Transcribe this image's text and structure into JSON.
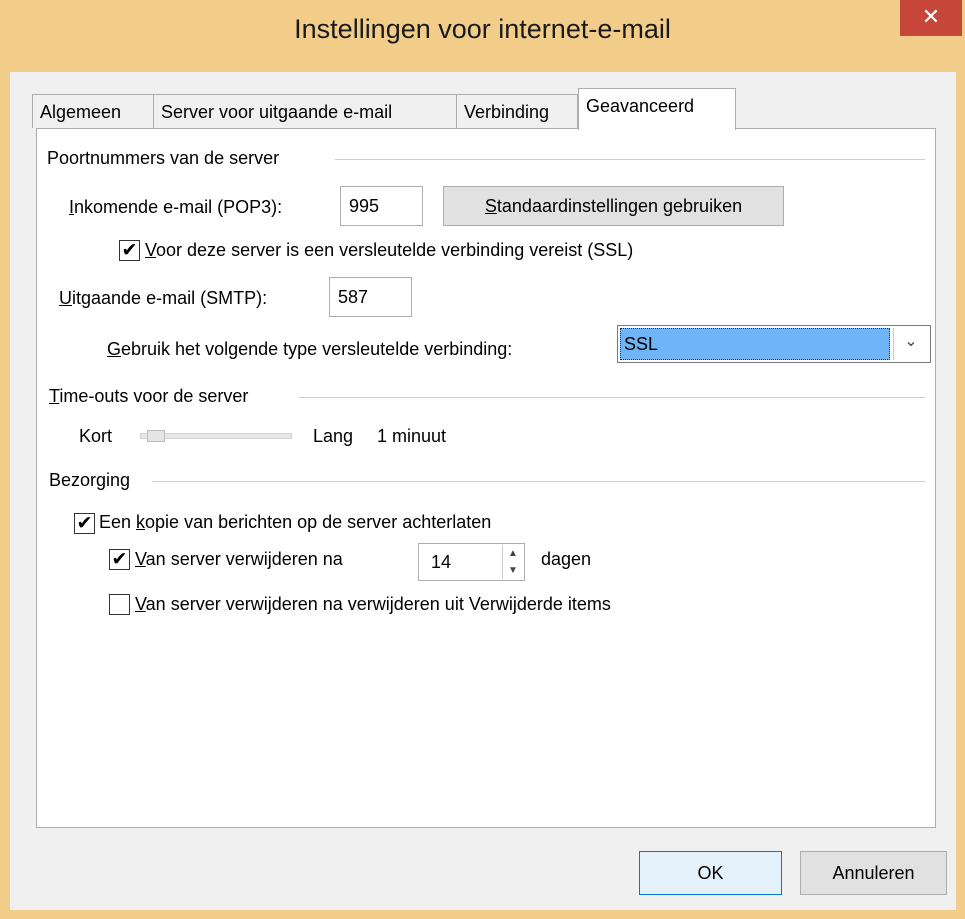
{
  "window": {
    "title": "Instellingen voor internet-e-mail",
    "close_glyph": "✕"
  },
  "tabs": [
    {
      "label": "Algemeen",
      "active": false
    },
    {
      "label": "Server voor uitgaande e-mail",
      "active": false
    },
    {
      "label": "Verbinding",
      "active": false
    },
    {
      "label": "Geavanceerd",
      "active": true
    }
  ],
  "ports": {
    "group_label": "Poortnummers van de server",
    "incoming_label_pre": "I",
    "incoming_label_rest": "nkomende e-mail (POP3):",
    "incoming_value": "995",
    "defaults_button_pre": "S",
    "defaults_button_rest": "tandaardinstellingen gebruiken",
    "ssl_required_pre": "V",
    "ssl_required_rest": "oor deze server is een versleutelde verbinding vereist (SSL)",
    "ssl_required_checked": true,
    "outgoing_label_pre": "U",
    "outgoing_label_rest": "itgaande e-mail (SMTP):",
    "outgoing_value": "587",
    "encryption_label_pre": "G",
    "encryption_label_rest": "ebruik het volgende type versleutelde verbinding:",
    "encryption_value": "SSL",
    "dropdown_icon": "chevron-down-icon",
    "dropdown_glyph": "⌄"
  },
  "timeouts": {
    "group_label_pre": "T",
    "group_label_rest": "ime-outs voor de server",
    "short_label": "Kort",
    "long_label": "Lang",
    "value_label": "1 minuut",
    "slider_level": 0.1
  },
  "delivery": {
    "group_label": "Bezorging",
    "leave_copy_pre": "Een ",
    "leave_copy_key": "k",
    "leave_copy_rest": "opie van berichten op de server achterlaten",
    "leave_copy_checked": true,
    "remove_after_pre": "V",
    "remove_after_rest": "an server verwijderen na",
    "remove_after_checked": true,
    "remove_after_days": "14",
    "days_label": "dagen",
    "remove_when_deleted_pre": "V",
    "remove_when_deleted_rest": "an server verwijderen na verwijderen uit Verwijderde items",
    "remove_when_deleted_checked": false
  },
  "footer": {
    "ok_label": "OK",
    "cancel_label": "Annuleren"
  },
  "check_glyph": "✔"
}
